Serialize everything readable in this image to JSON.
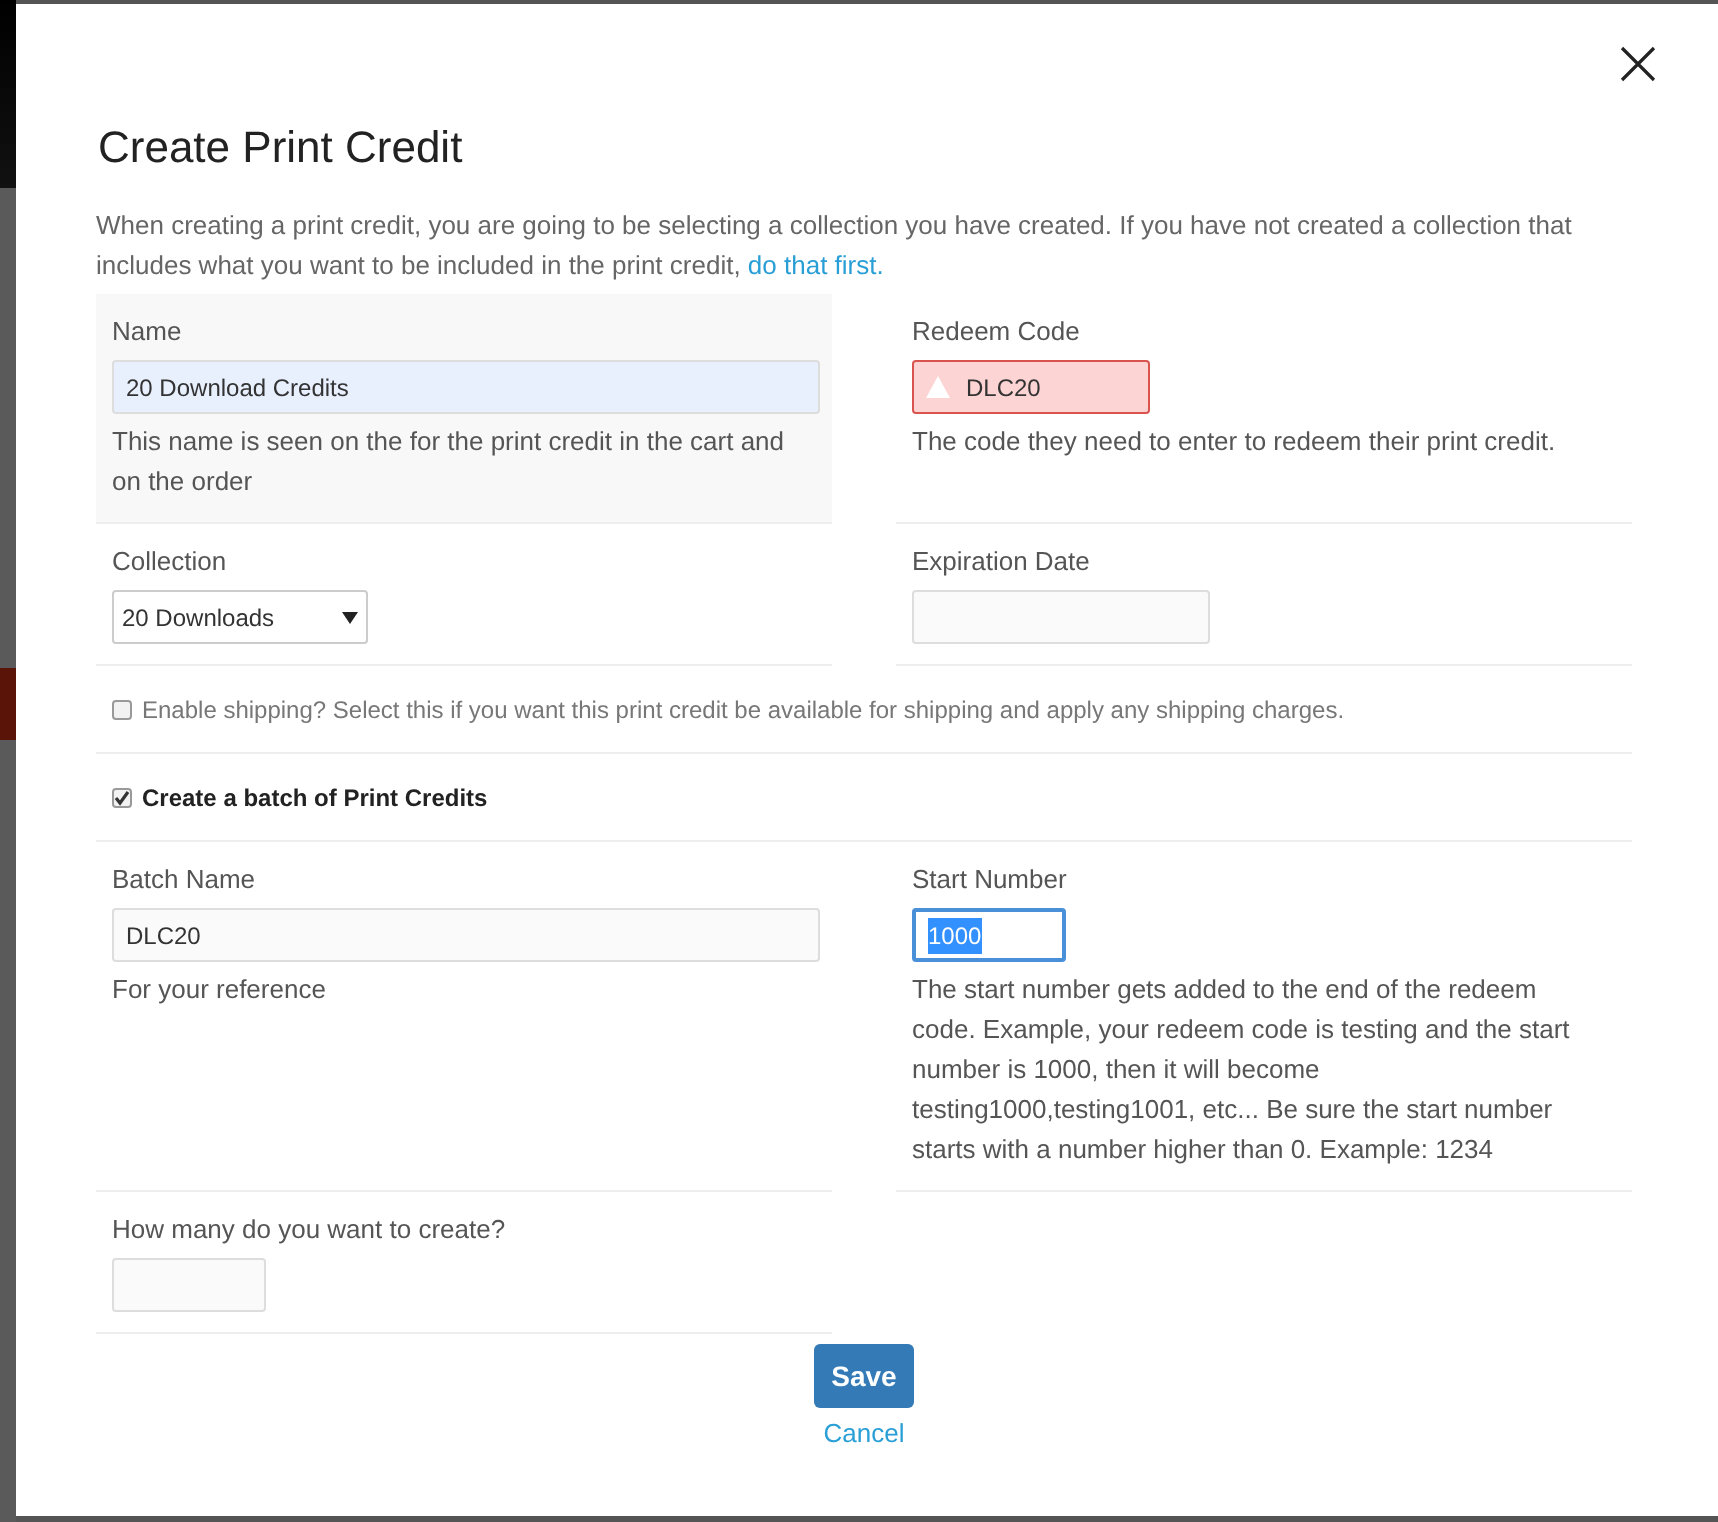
{
  "dialog": {
    "title": "Create Print Credit",
    "intro": "When creating a print credit, you are going to be selecting a collection you have created. If you have not created a collection that includes what you want to be included in the print credit,",
    "intro_link": "do that first.",
    "rows": [
      {
        "kind": "pair",
        "cells": [
          {
            "label": "Name",
            "kind": "text",
            "value": "20 Download Credits",
            "autofilled": true,
            "hovered": true,
            "help": "This name is seen on the for the print credit in the cart and on the order"
          },
          {
            "label": "Redeem Code",
            "kind": "text",
            "value": "DLC20",
            "invalid": true,
            "help": "The code they need to enter to redeem their print credit."
          }
        ]
      },
      {
        "kind": "pair",
        "cells": [
          {
            "label": "Collection",
            "kind": "select",
            "value": "20 Downloads"
          },
          {
            "label": "Expiration Date",
            "kind": "text"
          }
        ]
      },
      {
        "kind": "checkbox",
        "label": "Enable shipping? Select this if you want this print credit be available for shipping and apply any shipping charges.",
        "checked": false
      },
      {
        "kind": "checkbox",
        "label": "Create a batch of Print Credits",
        "checked": true
      },
      {
        "kind": "pair",
        "cells": [
          {
            "label": "Batch Name",
            "kind": "text",
            "value": "DLC20",
            "help": "For your reference"
          },
          {
            "label": "Start Number",
            "kind": "text",
            "value": "1000",
            "focused": true,
            "help": "The start number gets added to the end of the redeem code. Example, your redeem code is testing and the start number is 1000, then it will become testing1000,testing1001, etc... Be sure the start number starts with a number higher than 0. Example: 1234"
          }
        ]
      },
      {
        "kind": "pair",
        "cells": [
          {
            "label": "How many do you want to create?",
            "kind": "text"
          }
        ]
      }
    ],
    "save": "Save",
    "cancel": "Cancel"
  }
}
